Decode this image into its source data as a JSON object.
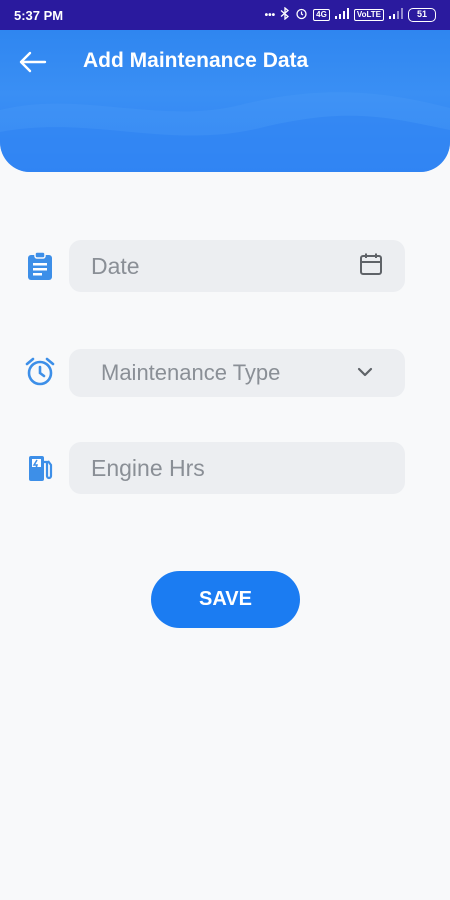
{
  "status_bar": {
    "time": "5:37 PM",
    "dots": "•••",
    "sim1": "4G",
    "sim2": "VoLTE",
    "battery": "51"
  },
  "header": {
    "title": "Add Maintenance Data"
  },
  "form": {
    "date_placeholder": "Date",
    "type_placeholder": "Maintenance Type",
    "engine_placeholder": "Engine Hrs",
    "save_label": "SAVE"
  },
  "colors": {
    "accent": "#1b7cf2",
    "icon": "#3d8fe8",
    "status_bar": "#2a1a9e"
  }
}
